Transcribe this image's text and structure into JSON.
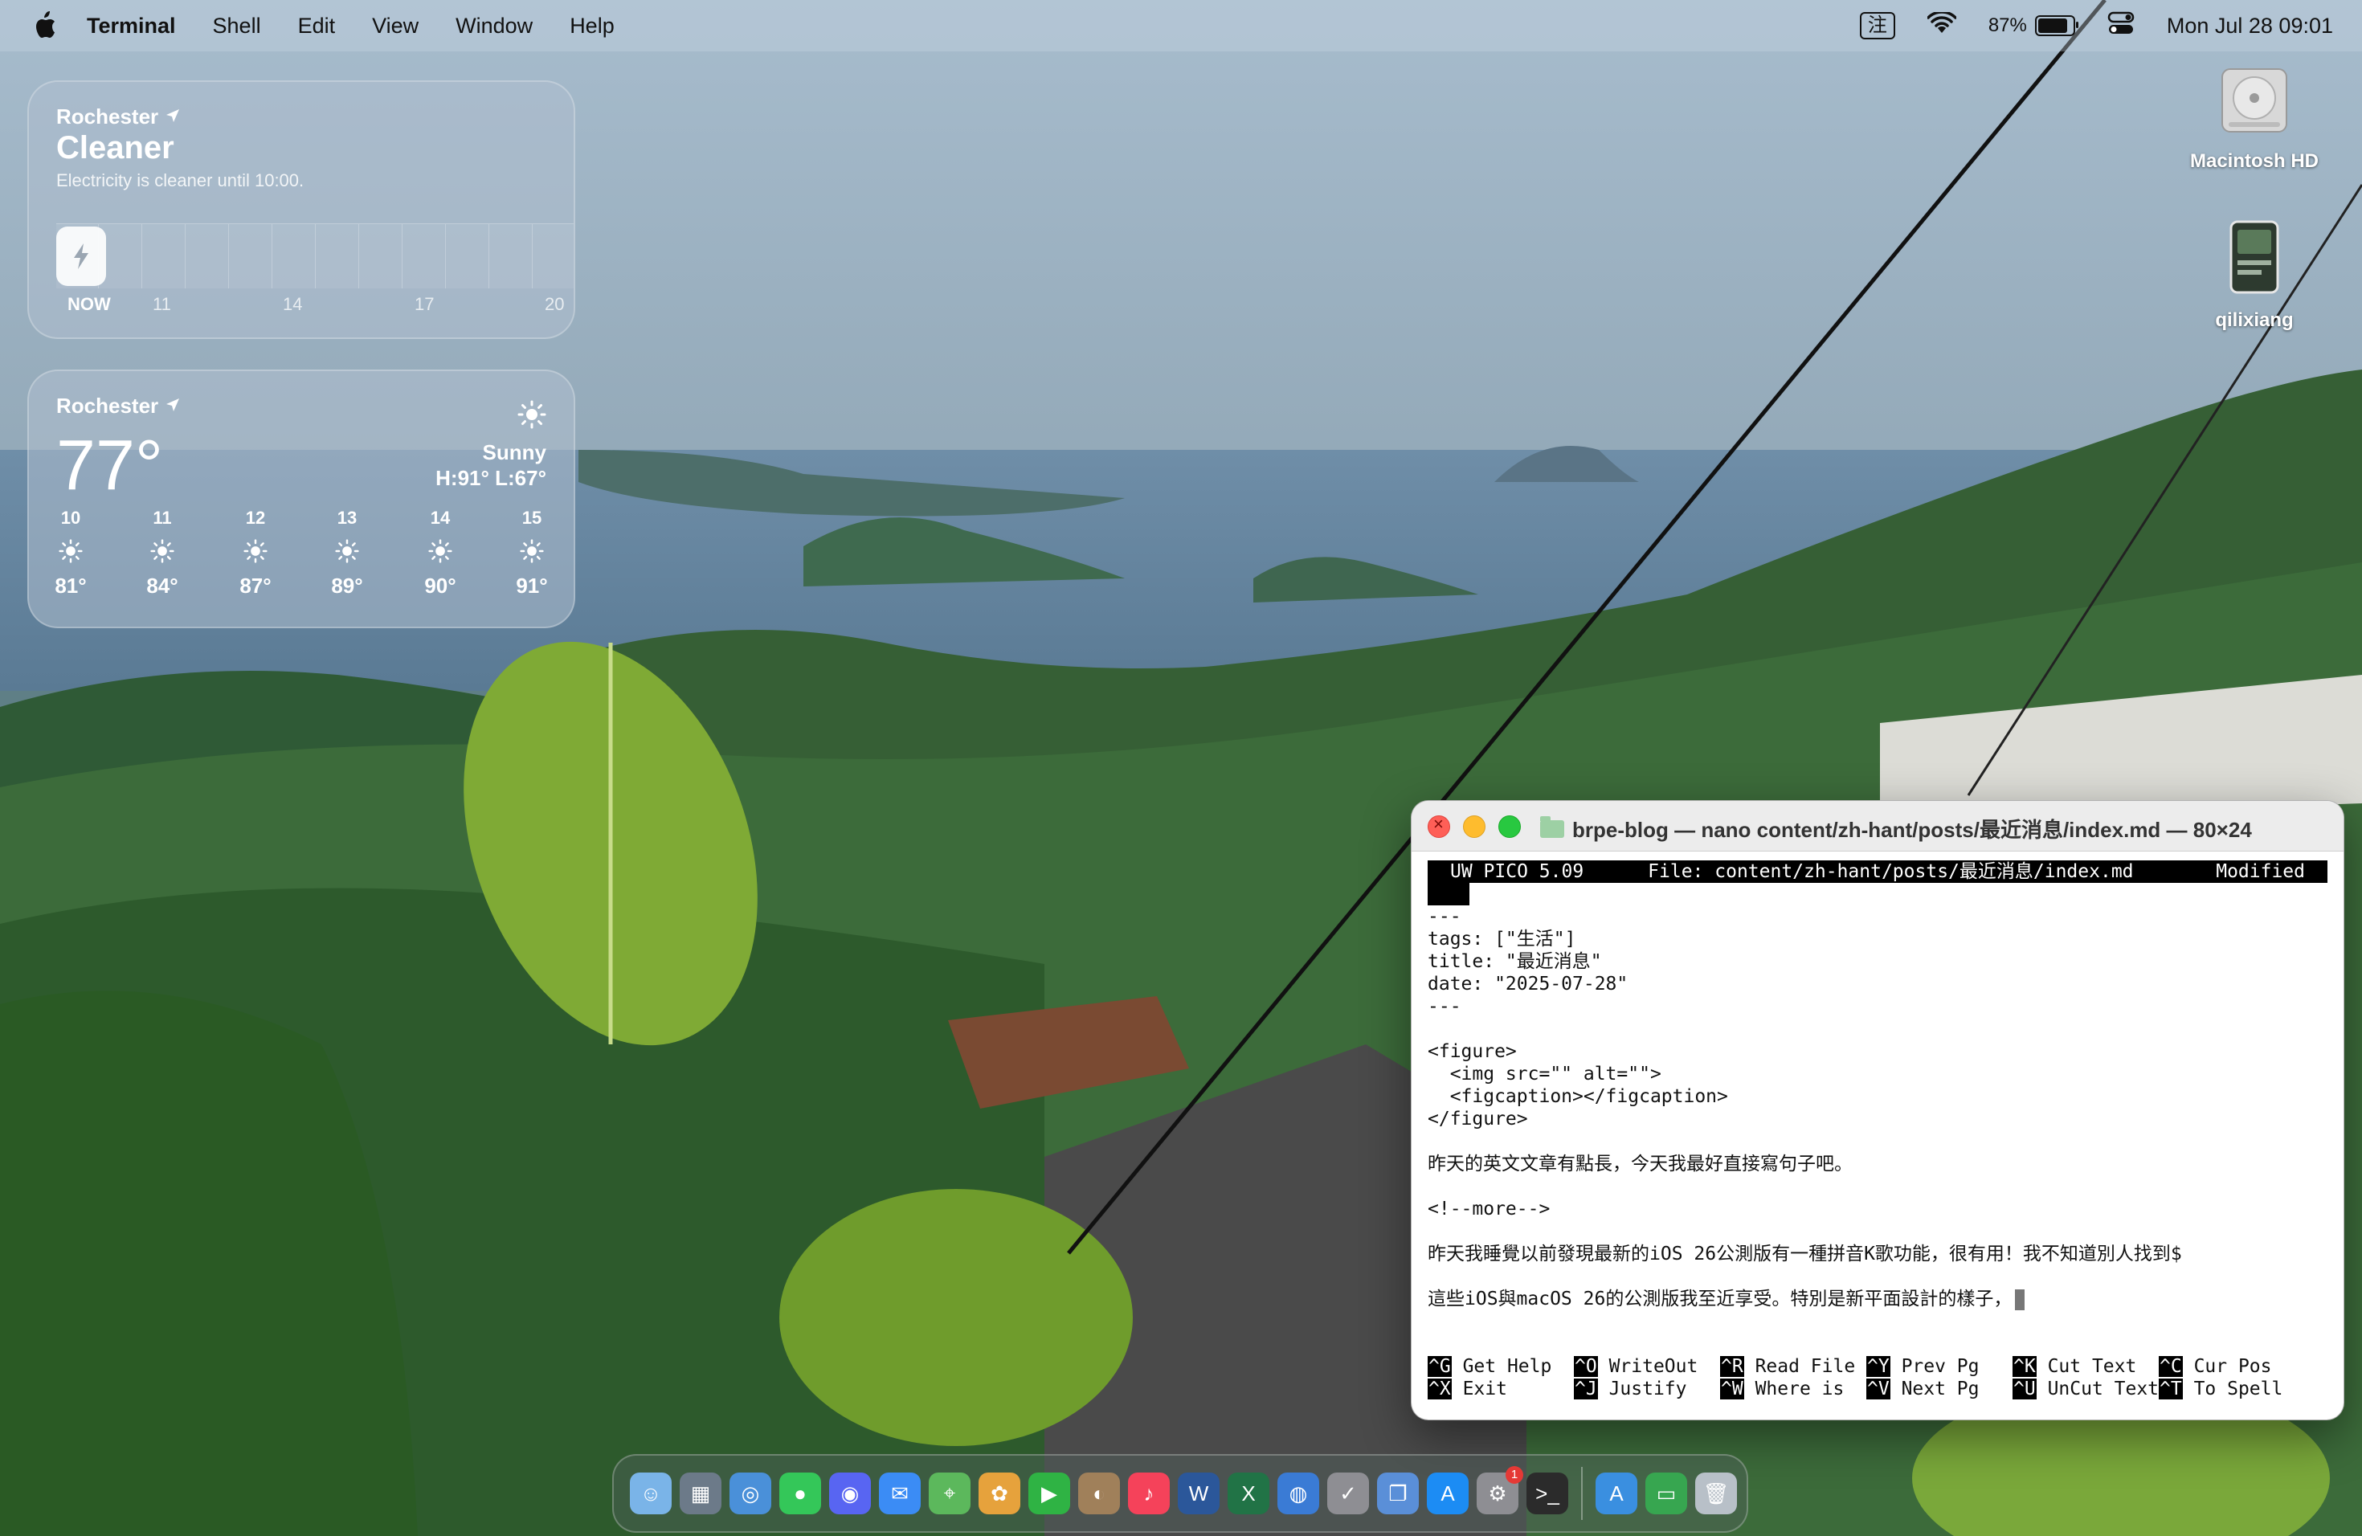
{
  "menubar": {
    "app_name": "Terminal",
    "items": [
      "Shell",
      "Edit",
      "View",
      "Window",
      "Help"
    ],
    "input_method": "注",
    "battery_percent": "87%",
    "battery_level": 0.87,
    "datetime": "Mon Jul 28  09:01"
  },
  "desktop": {
    "icons": [
      {
        "label": "Macintosh HD",
        "icon": "hard-drive-icon"
      },
      {
        "label": "qilixiang",
        "icon": "screenshot-file-icon"
      }
    ]
  },
  "widgets": {
    "clean_energy": {
      "location": "Rochester",
      "title": "Cleaner",
      "subtitle": "Electricity is cleaner until 10:00.",
      "axis_labels": [
        "NOW",
        "11",
        "14",
        "17",
        "20"
      ]
    },
    "weather": {
      "location": "Rochester",
      "temperature": "77°",
      "condition": "Sunny",
      "high_low": "H:91° L:67°",
      "forecast": [
        {
          "hour": "10",
          "temp": "81°"
        },
        {
          "hour": "11",
          "temp": "84°"
        },
        {
          "hour": "12",
          "temp": "87°"
        },
        {
          "hour": "13",
          "temp": "89°"
        },
        {
          "hour": "14",
          "temp": "90°"
        },
        {
          "hour": "15",
          "temp": "91°"
        }
      ]
    }
  },
  "terminal": {
    "title": "brpe-blog — nano content/zh-hant/posts/最近消息/index.md — 80×24",
    "pico_header": {
      "version": "UW PICO 5.09",
      "file": "File: content/zh-hant/posts/最近消息/index.md",
      "status": "Modified"
    },
    "lines": [
      "---",
      "tags: [\"生活\"]",
      "title: \"最近消息\"",
      "date: \"2025-07-28\"",
      "---",
      "",
      "<figure>",
      "  <img src=\"\" alt=\"\">",
      "  <figcaption></figcaption>",
      "</figure>",
      "",
      "昨天的英文文章有點長，今天我最好直接寫句子吧。",
      "",
      "<!--more-->",
      "",
      "昨天我睡覺以前發現最新的iOS 26公測版有一種拼音K歌功能，很有用！我不知道別人找到$",
      "",
      "這些iOS與macOS 26的公測版我至近享受。特別是新平面設計的樣子，"
    ],
    "shortcuts_row1": [
      {
        "key": "^G",
        "label": "Get Help"
      },
      {
        "key": "^O",
        "label": "WriteOut"
      },
      {
        "key": "^R",
        "label": "Read File"
      },
      {
        "key": "^Y",
        "label": "Prev Pg"
      },
      {
        "key": "^K",
        "label": "Cut Text"
      },
      {
        "key": "^C",
        "label": "Cur Pos"
      }
    ],
    "shortcuts_row2": [
      {
        "key": "^X",
        "label": "Exit"
      },
      {
        "key": "^J",
        "label": "Justify"
      },
      {
        "key": "^W",
        "label": "Where is"
      },
      {
        "key": "^V",
        "label": "Next Pg"
      },
      {
        "key": "^U",
        "label": "UnCut Text"
      },
      {
        "key": "^T",
        "label": "To Spell"
      }
    ]
  },
  "dock": {
    "apps": [
      {
        "name": "finder-icon",
        "color": "#7ab4e8",
        "glyph": "☺"
      },
      {
        "name": "launchpad-icon",
        "color": "#6c7a89",
        "glyph": "▦"
      },
      {
        "name": "safari-icon",
        "color": "#4a90d9",
        "glyph": "◎"
      },
      {
        "name": "messages-icon",
        "color": "#34c759",
        "glyph": "●"
      },
      {
        "name": "discord-icon",
        "color": "#5865f2",
        "glyph": "◉"
      },
      {
        "name": "mail-icon",
        "color": "#3b8cf5",
        "glyph": "✉"
      },
      {
        "name": "maps-icon",
        "color": "#5cb85c",
        "glyph": "⌖"
      },
      {
        "name": "photos-icon",
        "color": "#e6a23c",
        "glyph": "✿"
      },
      {
        "name": "facetime-icon",
        "color": "#2fb344",
        "glyph": "▶"
      },
      {
        "name": "contacts-icon",
        "color": "#a0805a",
        "glyph": "◐"
      },
      {
        "name": "music-icon",
        "color": "#f5425a",
        "glyph": "♪"
      },
      {
        "name": "word-icon",
        "color": "#2b579a",
        "glyph": "W"
      },
      {
        "name": "excel-icon",
        "color": "#217346",
        "glyph": "X"
      },
      {
        "name": "globe-icon",
        "color": "#3a7bd5",
        "glyph": "◍"
      },
      {
        "name": "reminders-icon",
        "color": "#8e8e93",
        "glyph": "✓"
      },
      {
        "name": "preview-icon",
        "color": "#5a8fd8",
        "glyph": "❐"
      },
      {
        "name": "app-store-icon",
        "color": "#1c8cf4",
        "glyph": "A"
      },
      {
        "name": "system-settings-icon",
        "color": "#8e8e93",
        "glyph": "⚙",
        "badge": "1"
      },
      {
        "name": "terminal-icon",
        "color": "#2b2b2b",
        "glyph": ">_"
      }
    ],
    "extras": [
      {
        "name": "applications-folder-icon",
        "color": "#3a8fe0",
        "glyph": "A"
      },
      {
        "name": "downloads-folder-icon",
        "color": "#37a650",
        "glyph": "▭"
      },
      {
        "name": "trash-icon",
        "color": "#b8c0c8",
        "glyph": "🗑"
      }
    ]
  }
}
